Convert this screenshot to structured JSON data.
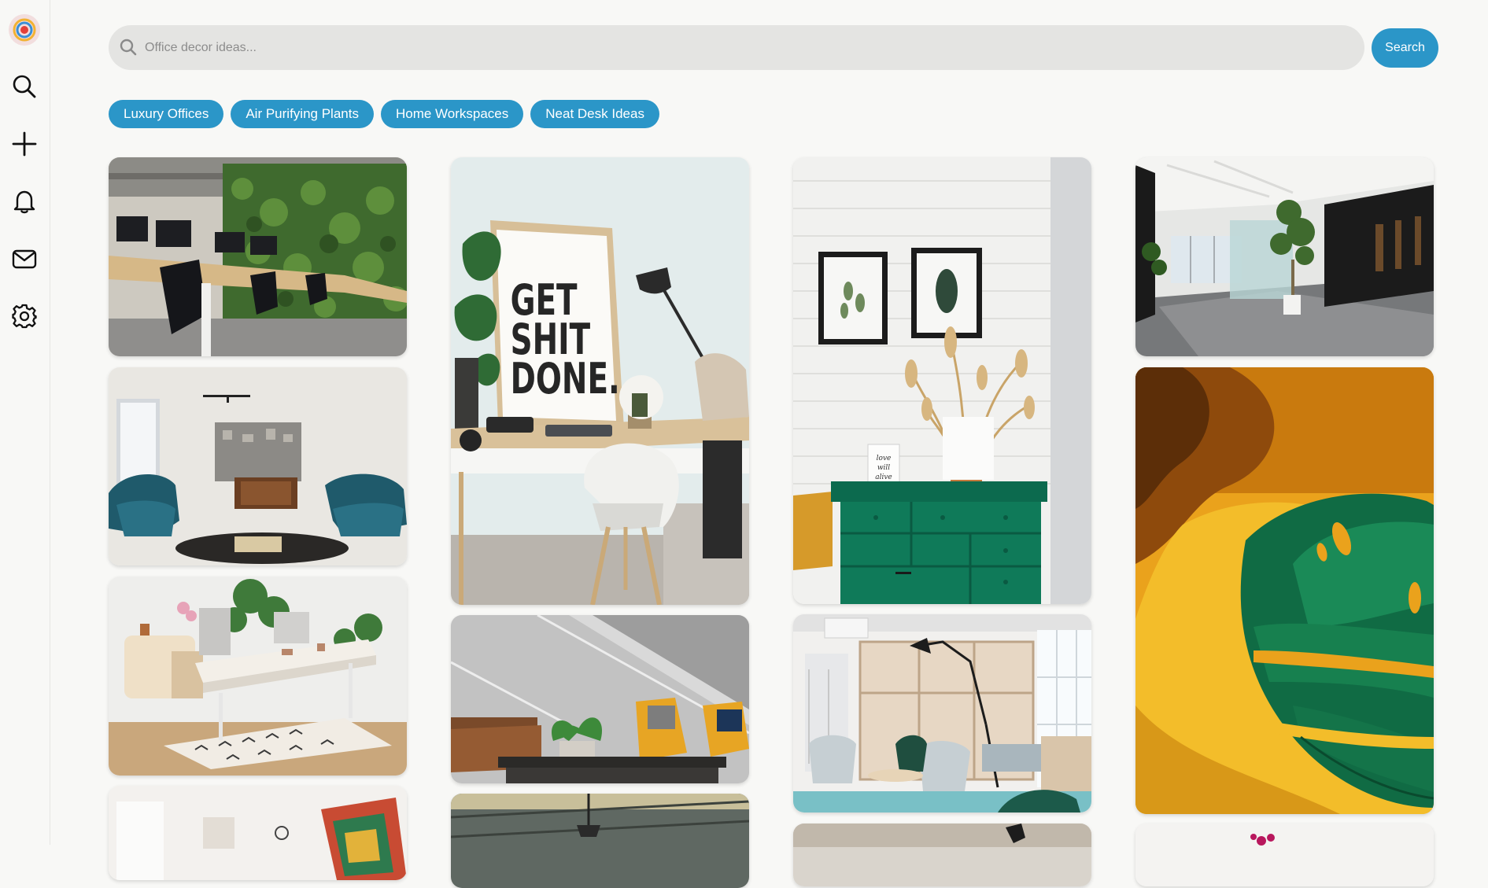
{
  "sidebar": {
    "items": [
      {
        "icon": "search-icon"
      },
      {
        "icon": "plus-icon"
      },
      {
        "icon": "bell-icon"
      },
      {
        "icon": "mail-icon"
      },
      {
        "icon": "gear-icon"
      }
    ]
  },
  "search": {
    "placeholder": "Office decor ideas...",
    "value": "",
    "button_label": "Search"
  },
  "chips": [
    "Luxury Offices",
    "Air Purifying Plants",
    "Home Workspaces",
    "Neat Desk Ideas"
  ],
  "poster": {
    "line1": "GET",
    "line2": "SHIT",
    "line3": "DONE."
  },
  "small_print": {
    "line1": "love",
    "line2": "will",
    "line3": "alive"
  },
  "colors": {
    "accent": "#2b96c8",
    "background": "#f8f8f6"
  }
}
